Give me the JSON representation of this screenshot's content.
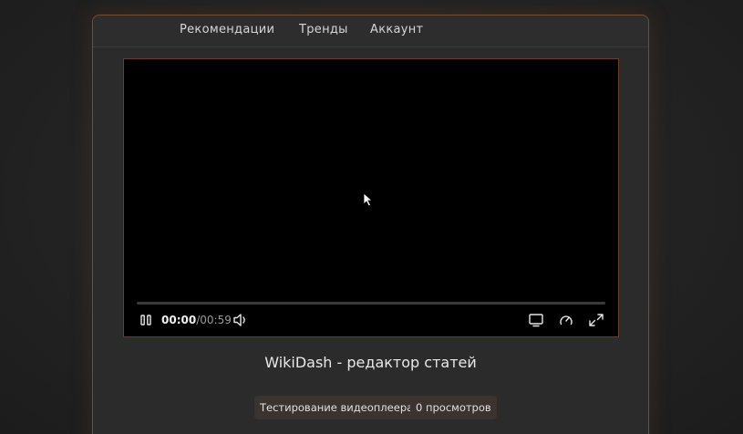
{
  "nav": {
    "items": [
      {
        "label": "Рекомендации"
      },
      {
        "label": "Тренды"
      },
      {
        "label": "Аккаунт"
      }
    ]
  },
  "player": {
    "current_time": "00:00",
    "separator": "/",
    "duration": "00:59",
    "progress": 0,
    "state": "playing",
    "icons": {
      "pause": "pause-icon",
      "volume": "volume-icon",
      "pip": "picture-in-picture-icon",
      "speed": "playback-speed-icon",
      "fullscreen": "fullscreen-icon"
    }
  },
  "video": {
    "title": "WikiDash - редактор статей",
    "tag": "Тестирование видеоплеера",
    "views": "0 просмотров"
  },
  "colors": {
    "accent": "#d07a40",
    "frame_border": "#7a4a30",
    "background": "#232323",
    "panel": "#2b2b2b",
    "chip": "#3a3330"
  }
}
